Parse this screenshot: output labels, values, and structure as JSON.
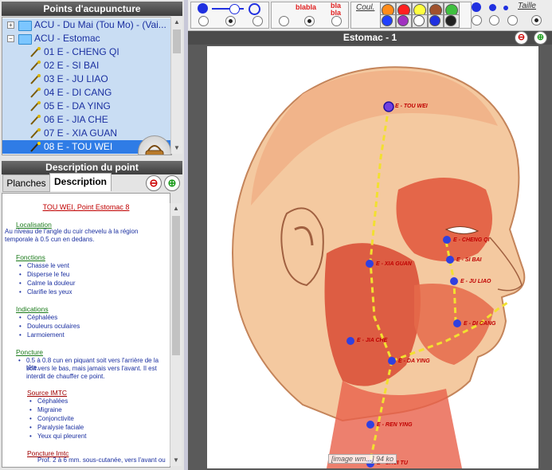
{
  "left": {
    "tree_title": "Points d'acupuncture",
    "tree": [
      {
        "label": "ACU - Du Mai (Tou Mo) - (Vai...",
        "type": "group",
        "expander": "+"
      },
      {
        "label": "ACU - Estomac",
        "type": "group",
        "expander": "−"
      },
      {
        "label": "01 E - CHENG QI",
        "type": "point"
      },
      {
        "label": "02 E - SI BAI",
        "type": "point"
      },
      {
        "label": "03 E - JU LIAO",
        "type": "point"
      },
      {
        "label": "04 E - DI CANG",
        "type": "point"
      },
      {
        "label": "05 E - DA YING",
        "type": "point"
      },
      {
        "label": "06 E - JIA CHE",
        "type": "point"
      },
      {
        "label": "07 E - XIA GUAN",
        "type": "point"
      },
      {
        "label": "08 E - TOU WEI",
        "type": "point",
        "selected": true
      }
    ],
    "desc_title": "Description du point",
    "tabs": [
      "Planches",
      "Description"
    ],
    "minus_glyph": "⊖",
    "plus_glyph": "⊕",
    "description": {
      "heading": "TOU WEI, Point  Estomac 8",
      "localisation_title": "Localisation",
      "localisation_text": [
        "Au niveau de l'angle du cuir chevelu à la région",
        "temporale à 0.5 cun en dedans."
      ],
      "fonctions_title": "Fonctions",
      "fonctions": [
        "Chasse le vent",
        "Disperse le feu",
        "Calme la douleur",
        "Clarifie les yeux"
      ],
      "indications_title": "Indications",
      "indications": [
        "Céphalées",
        "Douleurs oculaires",
        "Larmoiement"
      ],
      "poncture_title": "Poncture",
      "poncture_text": [
        "0.5 à 0.8 cun en piquant soit vers l'arrière de la tête,",
        "soit vers le bas, mais jamais vers l'avant. Il est",
        "interdit de chauffer ce point."
      ],
      "source_title": "Source IMTC",
      "source_items": [
        "Céphalées",
        "Migraine",
        "Conjonctivite",
        "Paralysie faciale",
        "Yeux qui pleurent"
      ],
      "poncture2_title": "Poncture Imtc",
      "poncture2_text": "Prof. 2 à 6 mm. sous-cutanée, vers l'avant ou"
    }
  },
  "right": {
    "toolbar": {
      "text_sample_1": "blabla",
      "text_sample_2a": "bla",
      "text_sample_2b": "bla",
      "couleur_label": "Coul.",
      "taille_label": "Taille",
      "colors": [
        "#ff8c1a",
        "#ff2020",
        "#ffff40",
        "#a0522d",
        "#40c040",
        "#2040ff",
        "#a030c0",
        "#ffffff"
      ],
      "accent": "#2030e0"
    },
    "view_title": "Estomac - 1",
    "caption": "[image wm...] 94 ko",
    "points": [
      {
        "label": "E - TOU WEI"
      },
      {
        "label": "E - XIA GUAN"
      },
      {
        "label": "E - CHENG QI"
      },
      {
        "label": "E - SI BAI"
      },
      {
        "label": "E - JU LIAO"
      },
      {
        "label": "E - DI CANG"
      },
      {
        "label": "E - JIA CHE"
      },
      {
        "label": "E - DA YING"
      },
      {
        "label": "E - REN YING"
      },
      {
        "label": "E - SHUI TU"
      }
    ]
  }
}
